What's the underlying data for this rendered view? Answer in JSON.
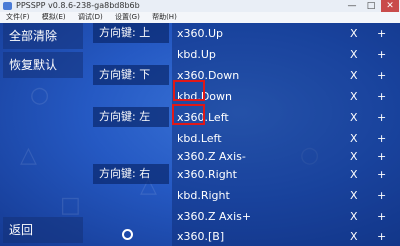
{
  "window": {
    "title": "PPSSPP v0.8.6-238-ga8bd8b6b",
    "min": "—",
    "max": "□",
    "close": "✕"
  },
  "menu": [
    "文件(F)",
    "模拟(E)",
    "调试(D)",
    "设置(G)",
    "帮助(H)"
  ],
  "sidebar": {
    "clear_all": "全部清除",
    "restore_default": "恢复默认",
    "back": "返回"
  },
  "groups": [
    {
      "label": "方向键: 上",
      "rows": [
        {
          "binding": "x360.Up",
          "x": "X",
          "plus": "+"
        },
        {
          "binding": "kbd.Up",
          "x": "X",
          "plus": "+"
        }
      ]
    },
    {
      "label": "方向键: 下",
      "rows": [
        {
          "binding": "x360.Down",
          "x": "X",
          "plus": "+"
        },
        {
          "binding": "kbd.Down",
          "x": "X",
          "plus": "+"
        }
      ]
    },
    {
      "label": "方向键: 左",
      "rows": [
        {
          "binding": "x360.Left",
          "x": "X",
          "plus": "+"
        },
        {
          "binding": "kbd.Left",
          "x": "X",
          "plus": "+"
        },
        {
          "binding": "x360.Z Axis-",
          "x": "X",
          "plus": "+"
        }
      ]
    },
    {
      "label": "方向键: 右",
      "rows": [
        {
          "binding": "x360.Right",
          "x": "X",
          "plus": "+"
        },
        {
          "binding": "kbd.Right",
          "x": "X",
          "plus": "+"
        },
        {
          "binding": "x360.Z Axis+",
          "x": "X",
          "plus": "+"
        }
      ]
    },
    {
      "label": "",
      "rows": [
        {
          "binding": "x360.[B]",
          "x": "X",
          "plus": "+"
        }
      ]
    }
  ],
  "highlight_color": "#e01818"
}
